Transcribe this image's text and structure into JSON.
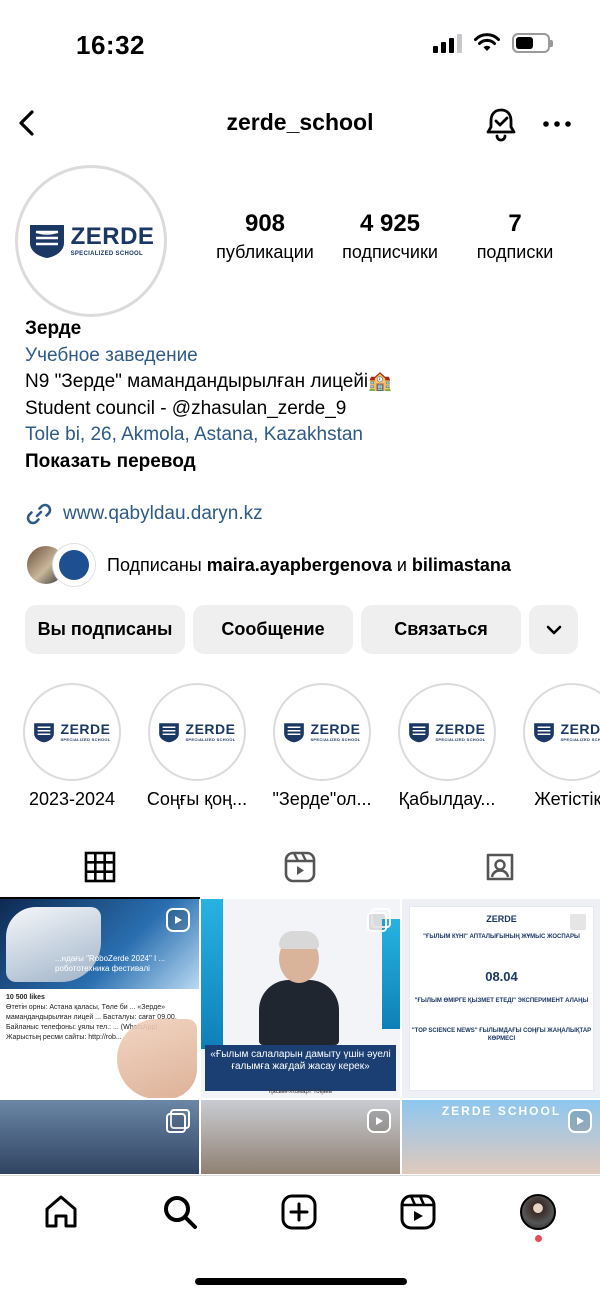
{
  "status": {
    "time": "16:32"
  },
  "nav": {
    "title": "zerde_school"
  },
  "profile": {
    "logo_word": "ZERDE",
    "logo_sub": "SPECIALIZED SCHOOL",
    "stats": [
      {
        "value": "908",
        "label": "публикации"
      },
      {
        "value": "4 925",
        "label": "подписчики"
      },
      {
        "value": "7",
        "label": "подписки"
      }
    ],
    "name": "Зерде",
    "category": "Учебное заведение",
    "bio_line1": "N9 \"Зерде\" мамандандырылған лицейі🏫",
    "bio_line2": "Student council - @zhasulan_zerde_9",
    "address": "Tole bi, 26, Akmola, Astana, Kazakhstan",
    "translate": "Показать перевод",
    "website": "www.qabyldau.daryn.kz"
  },
  "followed_by": {
    "prefix": "Подписаны ",
    "user1": "maira.ayapbergenovа",
    "joiner": " и ",
    "user2": "bilimastana"
  },
  "buttons": {
    "following": "Вы подписаны",
    "message": "Сообщение",
    "contact": "Связаться"
  },
  "highlights": [
    {
      "label": "2023-2024"
    },
    {
      "label": "Соңғы қоң..."
    },
    {
      "label": "\"Зерде\"ол..."
    },
    {
      "label": "Қабылдау..."
    },
    {
      "label": "Жетістікт"
    }
  ],
  "posts": {
    "t1_caption": "...ндағы \"RoboZerde 2024\" I ... робототехника фестивалі",
    "t1_likes": "10 500 likes",
    "t1_text": "Өтетін орны: Астана қаласы, Төле би ... «Зерде» мамандандырылған лицей ... Басталуы: сағат 09.00. Байланыс телефоны: ұялы тел.: ... (WhatsApp) Жарыстың ресми сайты: http://rob...",
    "t2_quote": "«Ғылым салаларын дамыту үшін әуелі ғалымға жағдай жасау керек»",
    "t2_sign": "Қасым-Жомарт Тоқаев",
    "t3_head": "ZERDE",
    "t3_title": "\"ҒЫЛЫМ КҮНІ\" АПТАЛЫҒЫНЫҢ ЖҰМЫС ЖОСПАРЫ",
    "t3_date": "08.04",
    "t3_item1": "\"ҒЫЛЫМ ӨМІРГЕ ҚЫЗМЕТ ЕТЕДІ\" ЭКСПЕРИМЕНТ АЛАҢЫ",
    "t3_item2": "\"TOP SCIENCE NEWS\" ҒЫЛЫМДАҒЫ СОҢҒЫ ЖАҢАЛЫҚТАР КӨРМЕСІ",
    "t6_text": "ZERDE SCHOOL"
  }
}
